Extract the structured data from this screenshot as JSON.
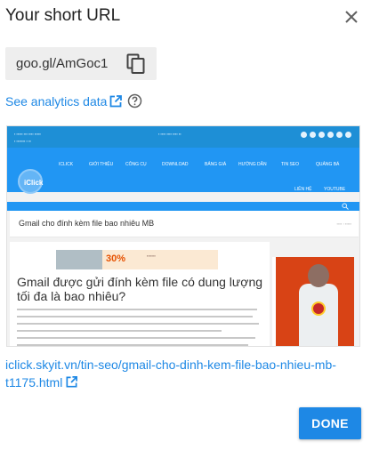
{
  "dialog": {
    "title": "Your short URL",
    "short_url": "goo.gl/AmGoc1",
    "analytics_link": "See analytics data",
    "long_url": "iclick.skyit.vn/tin-seo/gmail-cho-dinh-kem-file-bao-nhieu-mb-t1175.html",
    "done_label": "DONE"
  },
  "icons": {
    "close": "close-icon",
    "copy": "copy-icon",
    "external_link": "open-in-new-icon",
    "help": "help-circle-icon"
  },
  "preview": {
    "logo": "iClick",
    "menu": [
      "ICLICK",
      "GIỚI THIỆU",
      "CÔNG CỤ",
      "DOWNLOAD",
      "BẢNG GIÁ",
      "HƯỚNG DẪN",
      "TIN SEO",
      "QUẢNG BÁ"
    ],
    "menu_row2": [
      "LIÊN HỆ",
      "YOUTUBE"
    ],
    "page_heading": "Gmail cho đính kèm file bao nhiêu MB",
    "banner_text": "30%",
    "article_title": "Gmail được gửi đính kèm file có dung lượng tối đa là bao nhiêu?"
  },
  "colors": {
    "accent": "#1e88e5",
    "site_blue": "#2196f3",
    "chip_bg": "#eeeeee"
  }
}
